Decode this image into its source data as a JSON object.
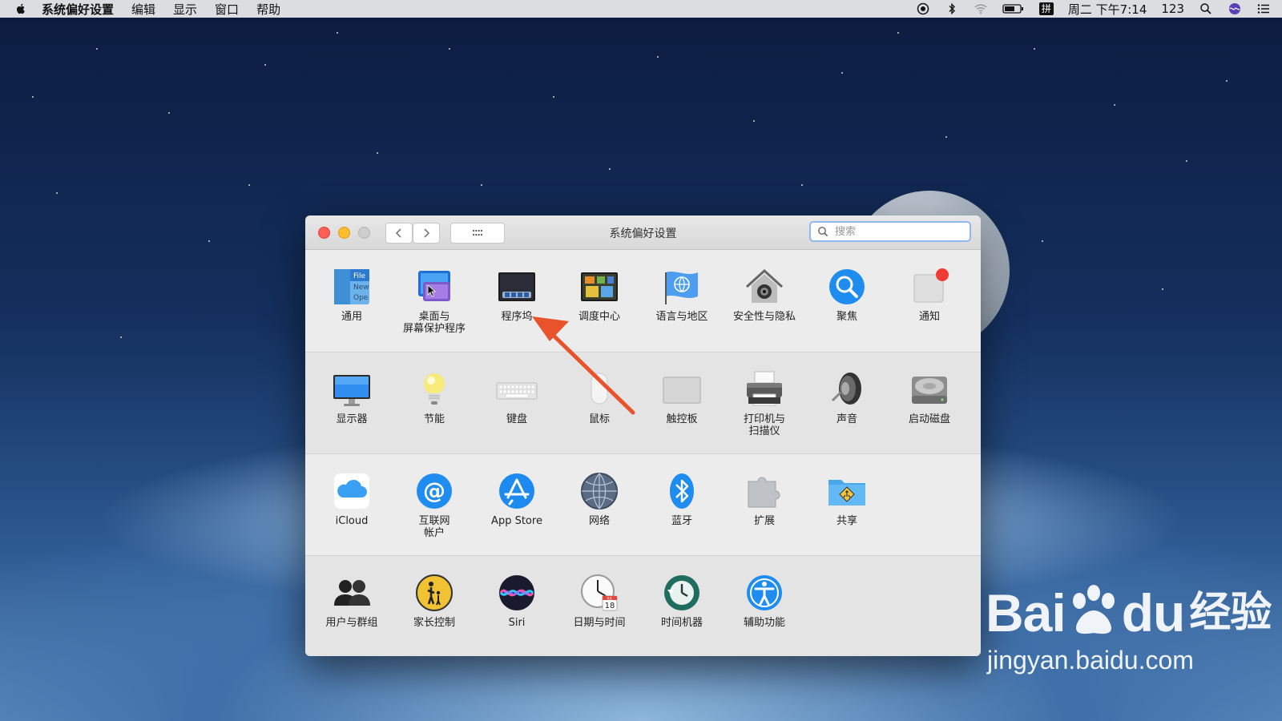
{
  "menubar": {
    "app_name": "系统偏好设置",
    "menus": [
      "编辑",
      "显示",
      "窗口",
      "帮助"
    ],
    "clock": "周二 下午7:14",
    "input_num": "123",
    "ime": "拼"
  },
  "window": {
    "title": "系统偏好设置",
    "search_placeholder": "搜索"
  },
  "panes": {
    "row1": [
      "通用",
      "桌面与\n屏幕保护程序",
      "程序坞",
      "调度中心",
      "语言与地区",
      "安全性与隐私",
      "聚焦",
      "通知"
    ],
    "row2": [
      "显示器",
      "节能",
      "键盘",
      "鼠标",
      "触控板",
      "打印机与\n扫描仪",
      "声音",
      "启动磁盘"
    ],
    "row3": [
      "iCloud",
      "互联网\n帐户",
      "App Store",
      "网络",
      "蓝牙",
      "扩展",
      "共享"
    ],
    "row4": [
      "用户与群组",
      "家长控制",
      "Siri",
      "日期与时间",
      "时间机器",
      "辅助功能"
    ]
  },
  "icon_text": {
    "general": [
      "File",
      "New",
      "Ope"
    ],
    "calendar_month": "JUL",
    "calendar_day": "18"
  },
  "colors": {
    "close": "#fd5f57",
    "minimize": "#febc2e",
    "zoom": "#cdcdcd",
    "arrow": "#e8532b",
    "accent": "#1f8cf0"
  },
  "watermark": {
    "brand_left": "Bai",
    "brand_right": "du",
    "brand_cn": "经验",
    "url": "jingyan.baidu.com"
  }
}
